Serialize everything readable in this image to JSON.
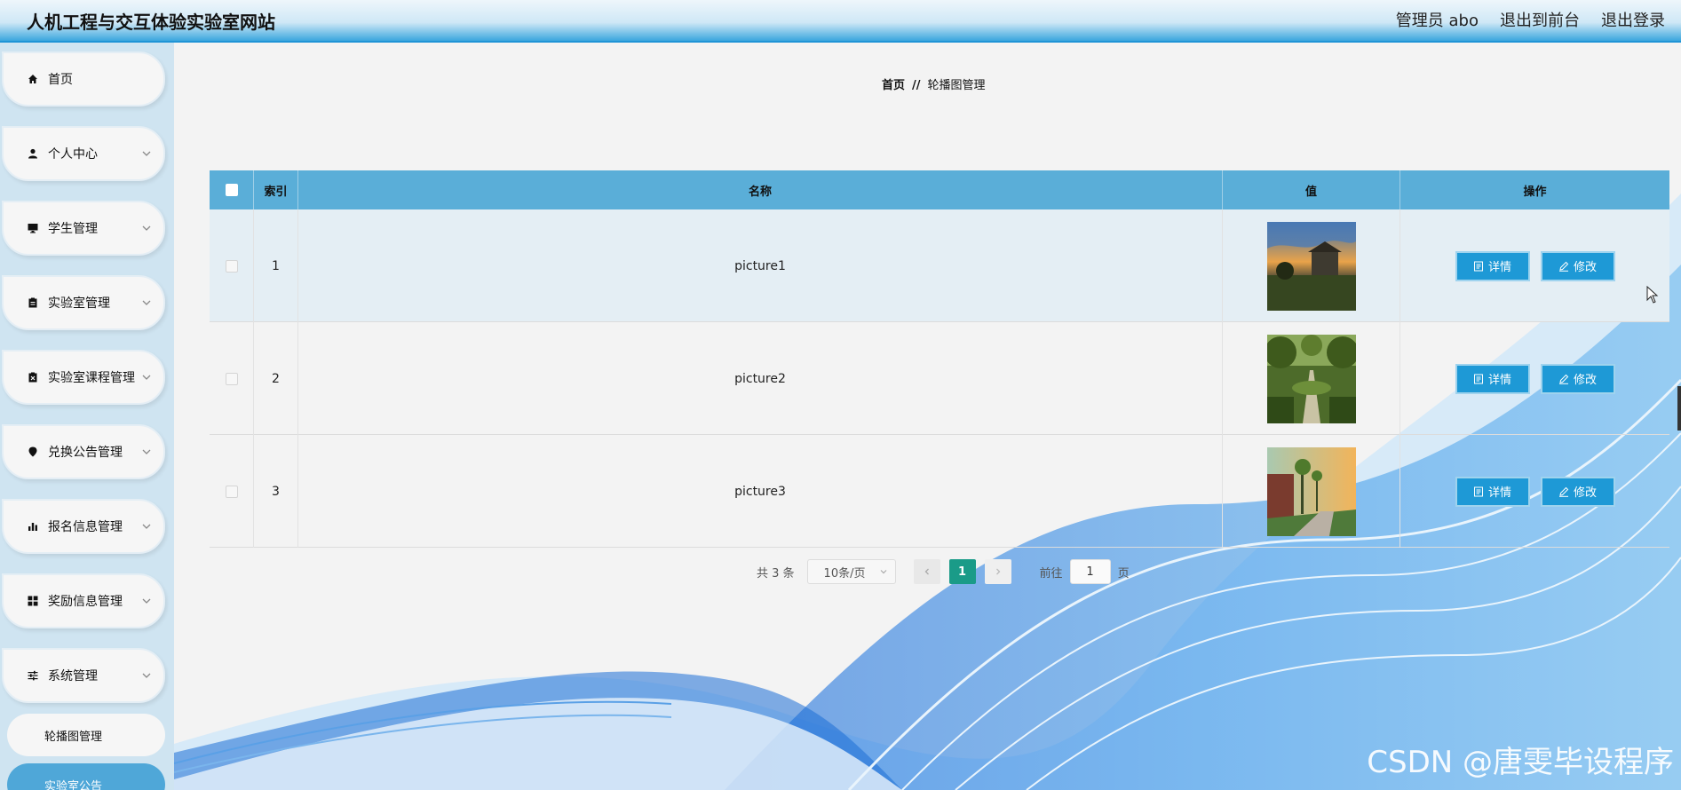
{
  "header": {
    "title": "人机工程与交互体验实验室网站",
    "user_label": "管理员 abo",
    "to_front": "退出到前台",
    "logout": "退出登录"
  },
  "sidebar": {
    "items": [
      {
        "label": "首页",
        "icon": "home-icon"
      },
      {
        "label": "个人中心",
        "icon": "user-icon"
      },
      {
        "label": "学生管理",
        "icon": "monitor-icon"
      },
      {
        "label": "实验室管理",
        "icon": "clipboard-icon"
      },
      {
        "label": "实验室课程管理",
        "icon": "clipboard-x-icon"
      },
      {
        "label": "兑换公告管理",
        "icon": "pin-icon"
      },
      {
        "label": "报名信息管理",
        "icon": "bar-chart-icon"
      },
      {
        "label": "奖励信息管理",
        "icon": "grid-icon"
      },
      {
        "label": "系统管理",
        "icon": "sliders-icon"
      }
    ],
    "sub_items": [
      {
        "label": "轮播图管理"
      },
      {
        "label": "实验室公告"
      }
    ]
  },
  "breadcrumb": {
    "home": "首页",
    "sep": "//",
    "current": "轮播图管理"
  },
  "table": {
    "headers": {
      "index": "索引",
      "name": "名称",
      "value": "值",
      "actions": "操作"
    },
    "rows": [
      {
        "index": "1",
        "name": "picture1",
        "image": "sunset-building-photo"
      },
      {
        "index": "2",
        "name": "picture2",
        "image": "tree-lined-path-photo"
      },
      {
        "index": "3",
        "name": "picture3",
        "image": "campus-street-photo"
      }
    ],
    "detail_label": "详情",
    "edit_label": "修改"
  },
  "pagination": {
    "total": "共 3 条",
    "page_size": "10条/页",
    "current_page": "1",
    "goto_prefix": "前往",
    "goto_value": "1",
    "goto_suffix": "页"
  },
  "watermark": "CSDN @唐雯毕设程序",
  "colors": {
    "header_blue": "#1f94d6",
    "table_head": "#5aaed8",
    "button": "#1e99d6",
    "page_active": "#1a9b88",
    "sidebar_bg": "#cfe4f1"
  }
}
